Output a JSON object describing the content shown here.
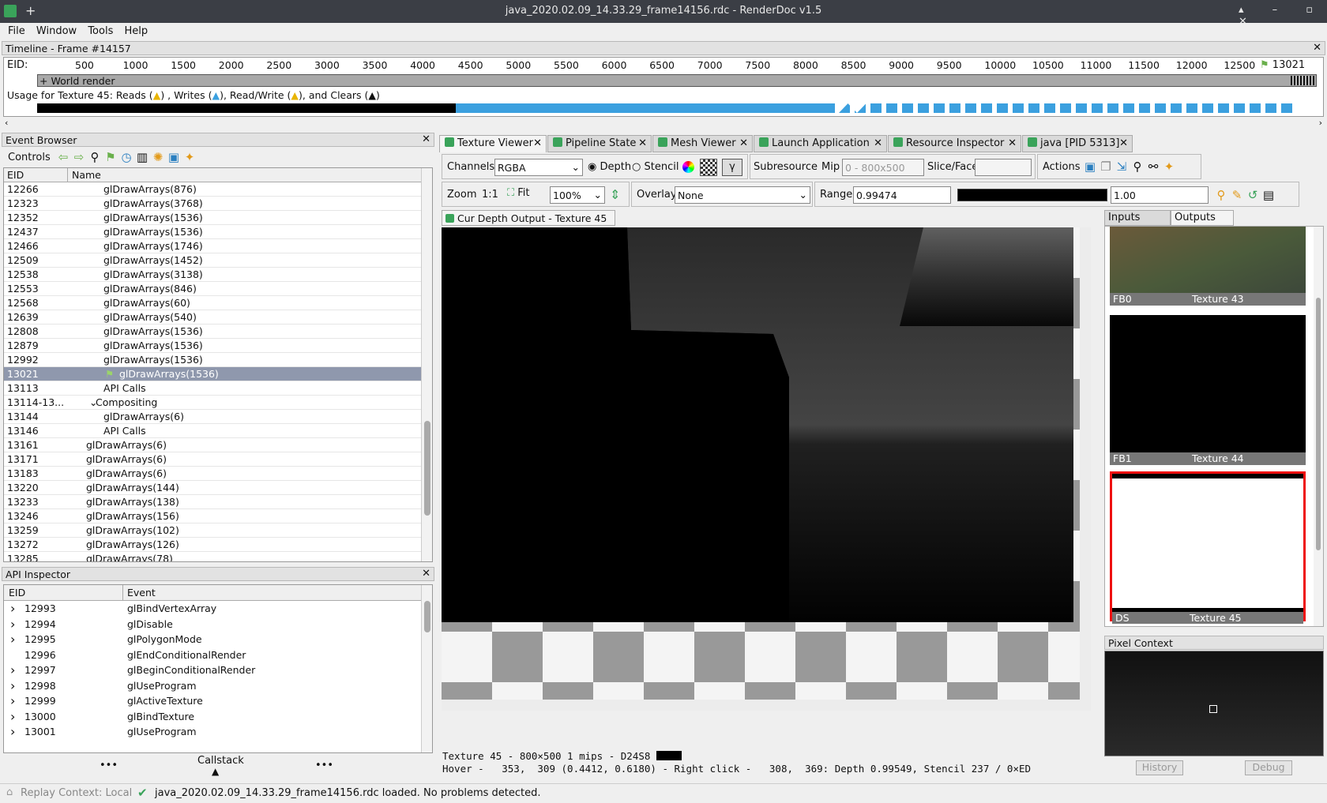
{
  "window": {
    "title": "java_2020.02.09_14.33.29_frame14156.rdc - RenderDoc v1.5",
    "plus": "+"
  },
  "menu": [
    "File",
    "Window",
    "Tools",
    "Help"
  ],
  "timeline": {
    "title": "Timeline - Frame #14157",
    "eid_label": "EID:",
    "ticks": [
      "500",
      "1000",
      "1500",
      "2000",
      "2500",
      "3000",
      "3500",
      "4000",
      "4500",
      "5000",
      "5500",
      "6000",
      "6500",
      "7000",
      "7500",
      "8000",
      "8500",
      "9000",
      "9500",
      "10000",
      "10500",
      "11000",
      "11500",
      "12000",
      "12500"
    ],
    "current_eid": "13021",
    "world_render": "+ World render",
    "usage_parts": [
      "Usage for Texture 45: Reads (",
      ") , Writes (",
      "), Read/Write (",
      "), and Clears (",
      ")"
    ]
  },
  "event_browser": {
    "title": "Event Browser",
    "controls_label": "Controls",
    "col_eid": "EID",
    "col_name": "Name",
    "rows": [
      {
        "eid": "12266",
        "name": "glDrawArrays(876)",
        "indent": 3
      },
      {
        "eid": "12323",
        "name": "glDrawArrays(3768)",
        "indent": 3
      },
      {
        "eid": "12352",
        "name": "glDrawArrays(1536)",
        "indent": 3
      },
      {
        "eid": "12437",
        "name": "glDrawArrays(1536)",
        "indent": 3
      },
      {
        "eid": "12466",
        "name": "glDrawArrays(1746)",
        "indent": 3
      },
      {
        "eid": "12509",
        "name": "glDrawArrays(1452)",
        "indent": 3
      },
      {
        "eid": "12538",
        "name": "glDrawArrays(3138)",
        "indent": 3
      },
      {
        "eid": "12553",
        "name": "glDrawArrays(846)",
        "indent": 3
      },
      {
        "eid": "12568",
        "name": "glDrawArrays(60)",
        "indent": 3
      },
      {
        "eid": "12639",
        "name": "glDrawArrays(540)",
        "indent": 3
      },
      {
        "eid": "12808",
        "name": "glDrawArrays(1536)",
        "indent": 3
      },
      {
        "eid": "12879",
        "name": "glDrawArrays(1536)",
        "indent": 3
      },
      {
        "eid": "12992",
        "name": "glDrawArrays(1536)",
        "indent": 3
      },
      {
        "eid": "13021",
        "name": "glDrawArrays(1536)",
        "indent": 4,
        "selected": true
      },
      {
        "eid": "13113",
        "name": "API Calls",
        "indent": 3
      },
      {
        "eid": "13114-13...",
        "name": "Compositing",
        "indent": 2,
        "expand": true
      },
      {
        "eid": "13144",
        "name": "glDrawArrays(6)",
        "indent": 3
      },
      {
        "eid": "13146",
        "name": "API Calls",
        "indent": 3
      },
      {
        "eid": "13161",
        "name": "glDrawArrays(6)",
        "indent": 2
      },
      {
        "eid": "13171",
        "name": "glDrawArrays(6)",
        "indent": 2
      },
      {
        "eid": "13183",
        "name": "glDrawArrays(6)",
        "indent": 2
      },
      {
        "eid": "13220",
        "name": "glDrawArrays(144)",
        "indent": 2
      },
      {
        "eid": "13233",
        "name": "glDrawArrays(138)",
        "indent": 2
      },
      {
        "eid": "13246",
        "name": "glDrawArrays(156)",
        "indent": 2
      },
      {
        "eid": "13259",
        "name": "glDrawArrays(102)",
        "indent": 2
      },
      {
        "eid": "13272",
        "name": "glDrawArrays(126)",
        "indent": 2
      },
      {
        "eid": "13285",
        "name": "glDrawArrays(78)",
        "indent": 2
      }
    ]
  },
  "api_inspector": {
    "title": "API Inspector",
    "col_eid": "EID",
    "col_event": "Event",
    "rows": [
      {
        "eid": "12993",
        "event": "glBindVertexArray",
        "exp": true
      },
      {
        "eid": "12994",
        "event": "glDisable",
        "exp": true
      },
      {
        "eid": "12995",
        "event": "glPolygonMode",
        "exp": true
      },
      {
        "eid": "12996",
        "event": "glEndConditionalRender",
        "exp": false
      },
      {
        "eid": "12997",
        "event": "glBeginConditionalRender",
        "exp": true
      },
      {
        "eid": "12998",
        "event": "glUseProgram",
        "exp": true
      },
      {
        "eid": "12999",
        "event": "glActiveTexture",
        "exp": true
      },
      {
        "eid": "13000",
        "event": "glBindTexture",
        "exp": true
      },
      {
        "eid": "13001",
        "event": "glUseProgram",
        "exp": true
      }
    ],
    "callstack": "Callstack",
    "dots": "•••"
  },
  "tabs": [
    "Texture Viewer",
    "Pipeline State",
    "Mesh Viewer",
    "Launch Application",
    "Resource Inspector",
    "java [PID 5313]"
  ],
  "toolbar": {
    "channels_label": "Channels",
    "channels_value": "RGBA",
    "depth": "Depth",
    "stencil": "Stencil",
    "gamma": "γ",
    "subresource": "Subresource",
    "mip": "Mip",
    "mip_value": "0 - 800x500",
    "slice": "Slice/Face",
    "actions": "Actions",
    "zoom": "Zoom",
    "zoom_ratio": "1:1",
    "fit": "Fit",
    "zoom_value": "100%",
    "overlay": "Overlay",
    "overlay_value": "None",
    "range": "Range",
    "range_min": "0.99474",
    "range_max": "1.00"
  },
  "viewer": {
    "tab": "Cur Depth Output - Texture 45",
    "status1": "Texture 45 - 800×500 1 mips - D24S8",
    "status2": "Hover -   353,  309 (0.4412, 0.6180) - Right click -   308,  369: Depth 0.99549, Stencil 237 / 0×ED"
  },
  "thumbs": {
    "tab_inputs": "Inputs",
    "tab_outputs": "Outputs",
    "items": [
      {
        "slot": "FB0",
        "name": "Texture 43"
      },
      {
        "slot": "FB1",
        "name": "Texture 44"
      },
      {
        "slot": "DS",
        "name": "Texture 45"
      }
    ]
  },
  "pixel_context": {
    "title": "Pixel Context",
    "history": "History",
    "debug": "Debug"
  },
  "statusbar": {
    "replay": "Replay Context: Local",
    "message": "java_2020.02.09_14.33.29_frame14156.rdc loaded. No problems detected."
  }
}
